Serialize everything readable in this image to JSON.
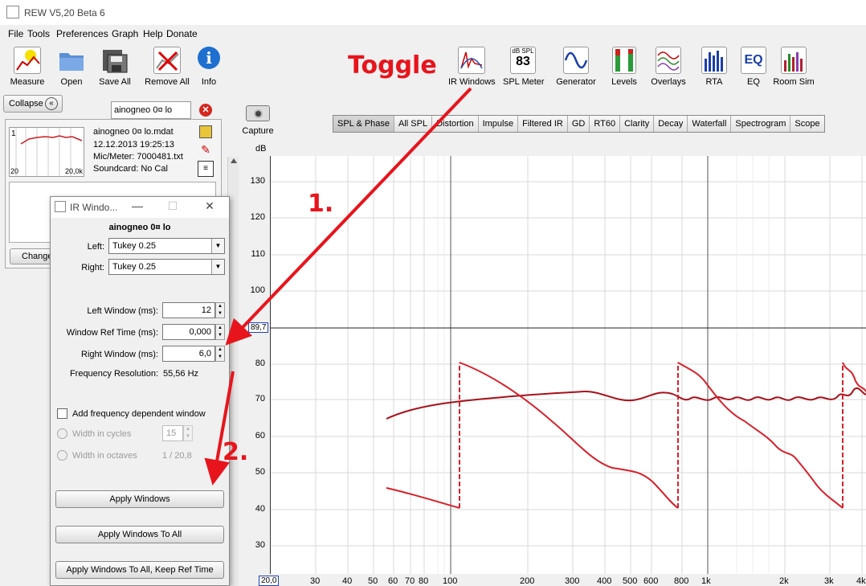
{
  "window": {
    "title": "REW V5,20 Beta 6"
  },
  "menu": [
    "File",
    "Tools",
    "Preferences",
    "Graph",
    "Help",
    "Donate"
  ],
  "toolbar_left": [
    {
      "label": "Measure",
      "icon": "measure-icon"
    },
    {
      "label": "Open",
      "icon": "folder-icon"
    },
    {
      "label": "Save All",
      "icon": "save-all-icon"
    },
    {
      "label": "Remove All",
      "icon": "remove-all-icon"
    },
    {
      "label": "Info",
      "icon": "info-icon"
    }
  ],
  "toolbar_right": [
    {
      "label": "IR Windows",
      "icon": "ir-windows-icon"
    },
    {
      "label": "SPL Meter",
      "icon": "spl-meter-icon",
      "badge_top": "dB SPL",
      "badge_value": "83"
    },
    {
      "label": "Generator",
      "icon": "generator-icon"
    },
    {
      "label": "Levels",
      "icon": "levels-icon"
    },
    {
      "label": "Overlays",
      "icon": "overlays-icon"
    },
    {
      "label": "RTA",
      "icon": "rta-icon"
    },
    {
      "label": "EQ",
      "icon": "eq-icon"
    },
    {
      "label": "Room Sim",
      "icon": "room-sim-icon"
    }
  ],
  "annotations": {
    "toggle": "Toggle",
    "step1": "1.",
    "step2": "2."
  },
  "sidebar": {
    "collapse_label": "Collapse",
    "measurement_name": "ainogneo 0¤ lo",
    "thumb_index": "1",
    "thumb_xmin": "20",
    "thumb_xmax": "20,0k",
    "file": "ainogneo 0¤ lo.mdat",
    "date": "12.12.2013 19:25:13",
    "mic": "Mic/Meter: 7000481.txt",
    "soundcard": "Soundcard: No Cal",
    "change_label": "Change"
  },
  "capture_label": "Capture",
  "tabs": [
    "SPL & Phase",
    "All SPL",
    "Distortion",
    "Impulse",
    "Filtered IR",
    "GD",
    "RT60",
    "Clarity",
    "Decay",
    "Waterfall",
    "Spectrogram",
    "Scope"
  ],
  "active_tab": "SPL & Phase",
  "graph": {
    "y_unit": "dB",
    "y_ticks": [
      "130",
      "120",
      "110",
      "100",
      "80",
      "70",
      "60",
      "50",
      "40",
      "30"
    ],
    "y_cursor": "89,7",
    "x_start": "20,0",
    "x_ticks": [
      "30",
      "40",
      "50",
      "60",
      "70",
      "80",
      "100",
      "200",
      "300",
      "400",
      "500",
      "600",
      "800",
      "1k",
      "2k",
      "3k",
      "4k"
    ]
  },
  "dialog": {
    "title": "IR Windo...",
    "measurement": "ainogneo 0¤ lo",
    "left_label": "Left:",
    "left_value": "Tukey 0.25",
    "right_label": "Right:",
    "right_value": "Tukey 0.25",
    "left_window_label": "Left Window (ms):",
    "left_window_value": "12",
    "ref_time_label": "Window Ref Time (ms):",
    "ref_time_value": "0,000",
    "right_window_label": "Right Window (ms):",
    "right_window_value": "6,0",
    "freq_res_label": "Frequency Resolution:",
    "freq_res_value": "55,56 Hz",
    "fdw_label": "Add frequency dependent window",
    "cycles_label": "Width in cycles",
    "cycles_value": "15",
    "octaves_label": "Width in octaves",
    "octaves_value": "1 / 20,8",
    "apply_label": "Apply Windows",
    "apply_all_label": "Apply Windows To All",
    "apply_all_keep_label": "Apply Windows To All, Keep Ref Time"
  },
  "colors": {
    "curve": "#c81e24",
    "annotation": "#e8141c",
    "cursor_box": "#2040c0"
  }
}
